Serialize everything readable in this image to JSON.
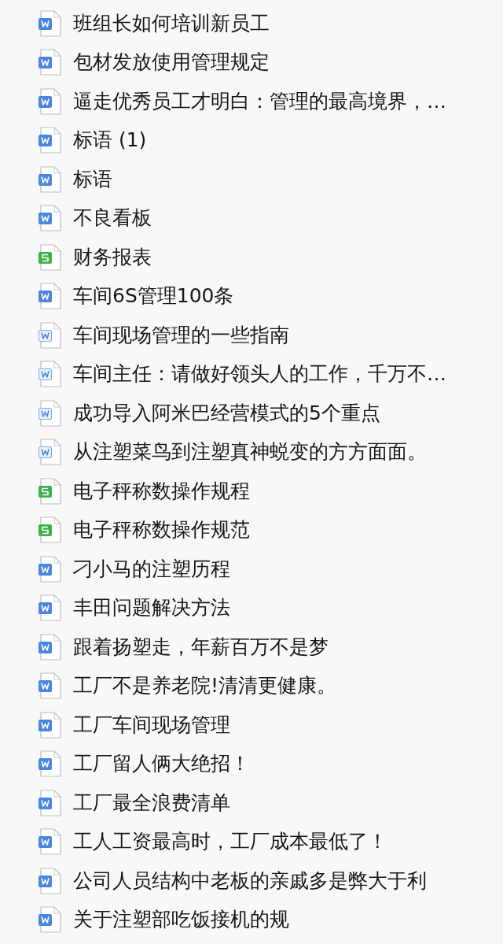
{
  "files": [
    {
      "name": "班组长如何培训新员工",
      "kind": "doc"
    },
    {
      "name": "包材发放使用管理规定",
      "kind": "doc"
    },
    {
      "name": "逼走优秀员工才明白：管理的最高境界，…",
      "kind": "doc"
    },
    {
      "name": "标语 (1)",
      "kind": "doc"
    },
    {
      "name": "标语",
      "kind": "doc"
    },
    {
      "name": "不良看板",
      "kind": "doc"
    },
    {
      "name": "财务报表",
      "kind": "sheet"
    },
    {
      "name": "车间6S管理100条",
      "kind": "doc"
    },
    {
      "name": "车间现场管理的一些指南",
      "kind": "word"
    },
    {
      "name": "车间主任：请做好领头人的工作，千万不…",
      "kind": "word"
    },
    {
      "name": "成功导入阿米巴经营模式的5个重点",
      "kind": "word"
    },
    {
      "name": "从注塑菜鸟到注塑真神蜕变的方方面面。",
      "kind": "word"
    },
    {
      "name": "电子秤称数操作规程",
      "kind": "sheet"
    },
    {
      "name": "电子秤称数操作规范",
      "kind": "sheet"
    },
    {
      "name": "刁小马的注塑历程",
      "kind": "doc"
    },
    {
      "name": "丰田问题解决方法",
      "kind": "doc"
    },
    {
      "name": "跟着扬塑走，年薪百万不是梦",
      "kind": "doc"
    },
    {
      "name": "工厂不是养老院!清清更健康。",
      "kind": "doc"
    },
    {
      "name": "工厂车间现场管理",
      "kind": "doc"
    },
    {
      "name": "工厂留人俩大绝招！",
      "kind": "doc"
    },
    {
      "name": "工厂最全浪费清单",
      "kind": "doc"
    },
    {
      "name": "工人工资最高时，工厂成本最低了！",
      "kind": "doc"
    },
    {
      "name": "公司人员结构中老板的亲戚多是弊大于利",
      "kind": "doc"
    },
    {
      "name": "关于注塑部吃饭接机的规",
      "kind": "doc"
    }
  ]
}
